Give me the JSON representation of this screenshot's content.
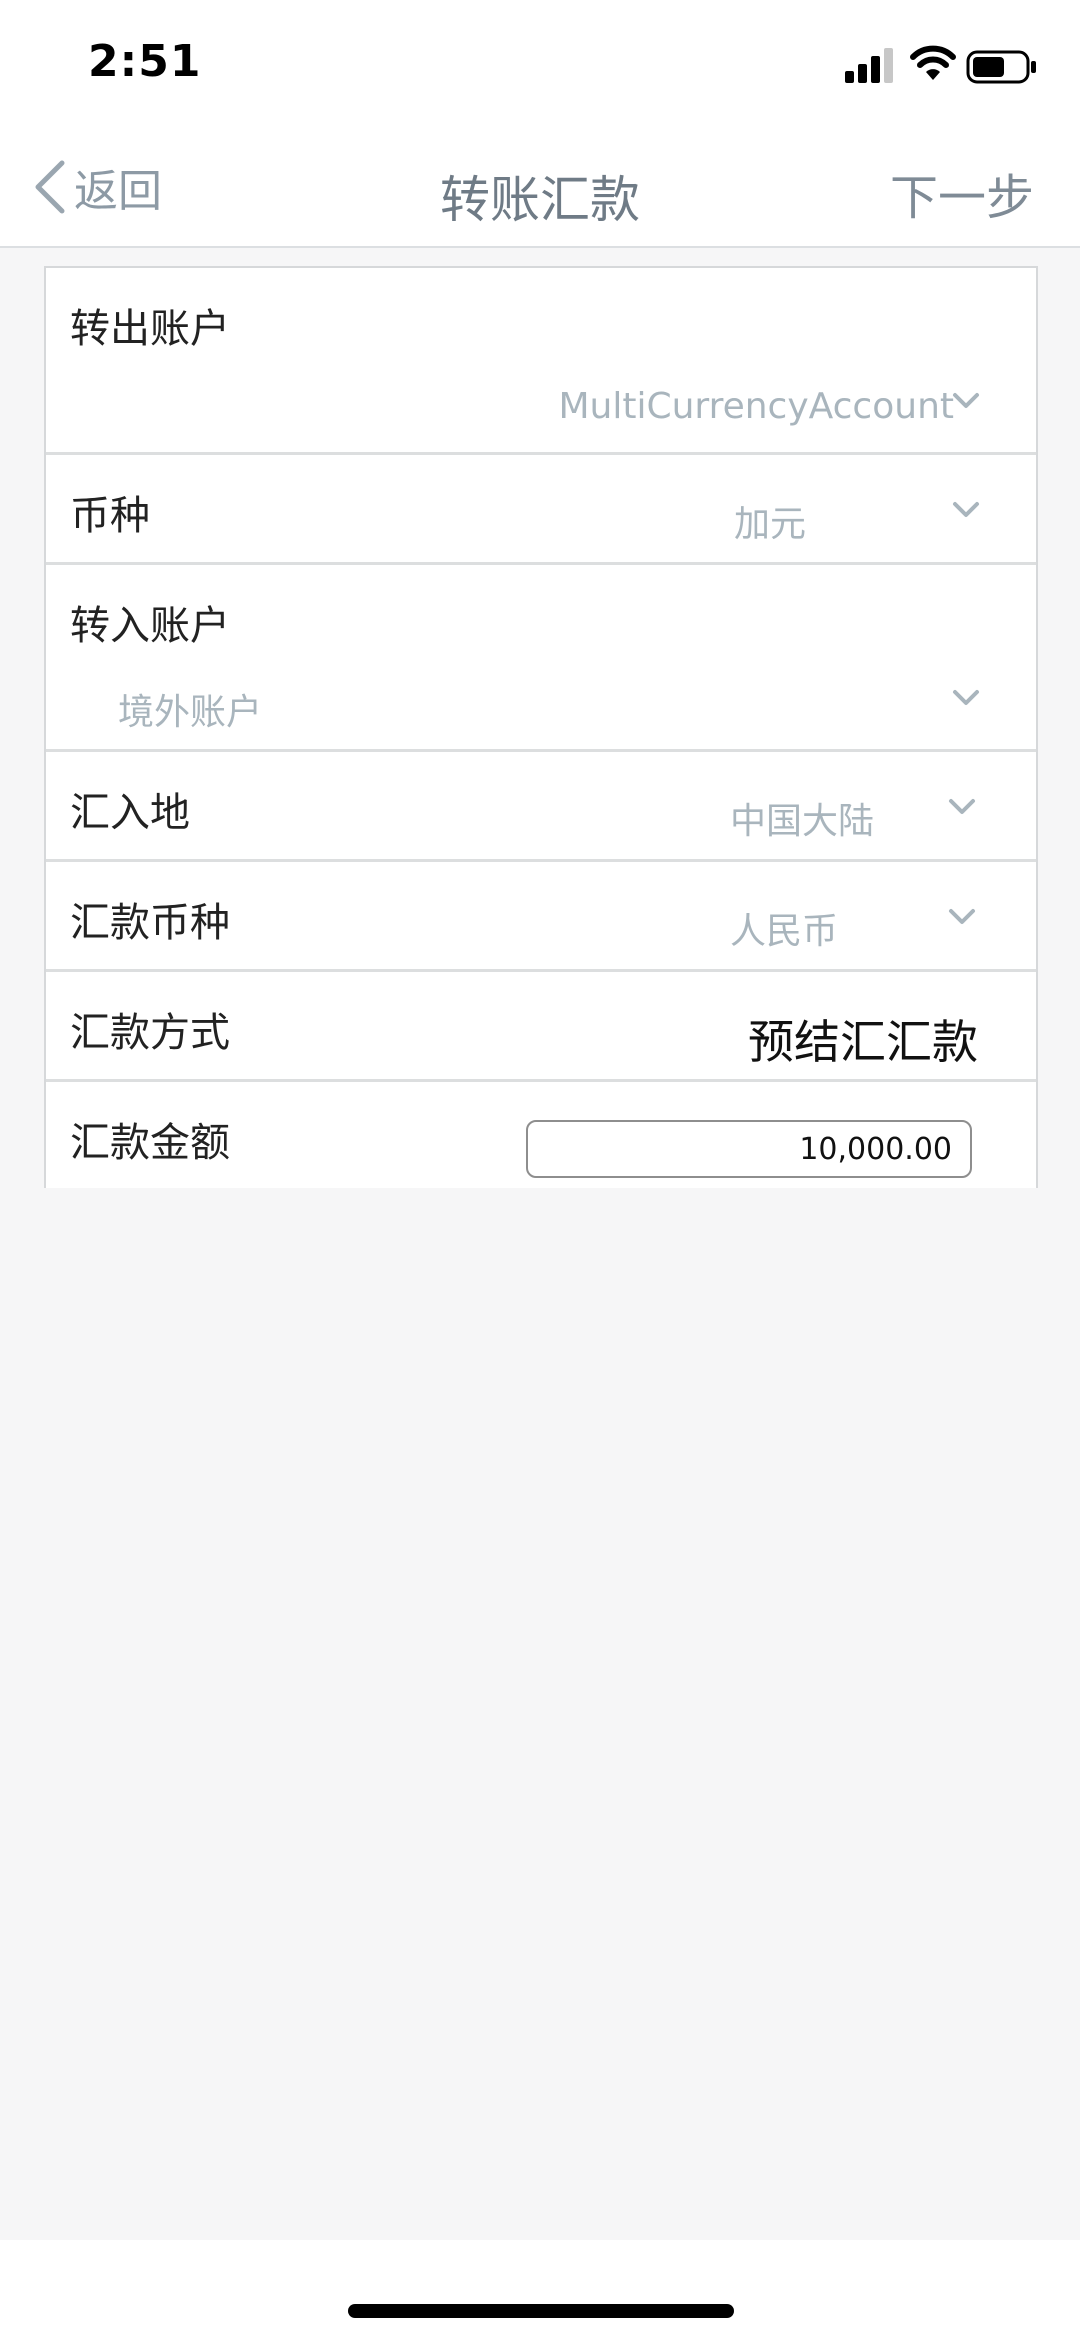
{
  "status_bar": {
    "time": "2:51",
    "icons": [
      "signal-icon",
      "wifi-icon",
      "battery-icon"
    ]
  },
  "nav": {
    "back_label": "返回",
    "title": "转账汇款",
    "next_label": "下一步"
  },
  "form": {
    "from_account": {
      "label": "转出账户",
      "value": "MultiCurrencyAccount"
    },
    "currency": {
      "label": "币种",
      "value": "加元"
    },
    "to_account": {
      "label": "转入账户",
      "value": "境外账户"
    },
    "destination": {
      "label": "汇入地",
      "value": "中国大陆"
    },
    "remit_currency": {
      "label": "汇款币种",
      "value": "人民币"
    },
    "remit_method": {
      "label": "汇款方式",
      "value": "预结汇汇款"
    },
    "amount": {
      "label": "汇款金额",
      "value": "10,000.00"
    }
  },
  "colors": {
    "accent_text": "#7f8b96",
    "placeholder_text": "#a9b5bd",
    "divider": "#dcdedf",
    "background": "#f6f6f7"
  }
}
